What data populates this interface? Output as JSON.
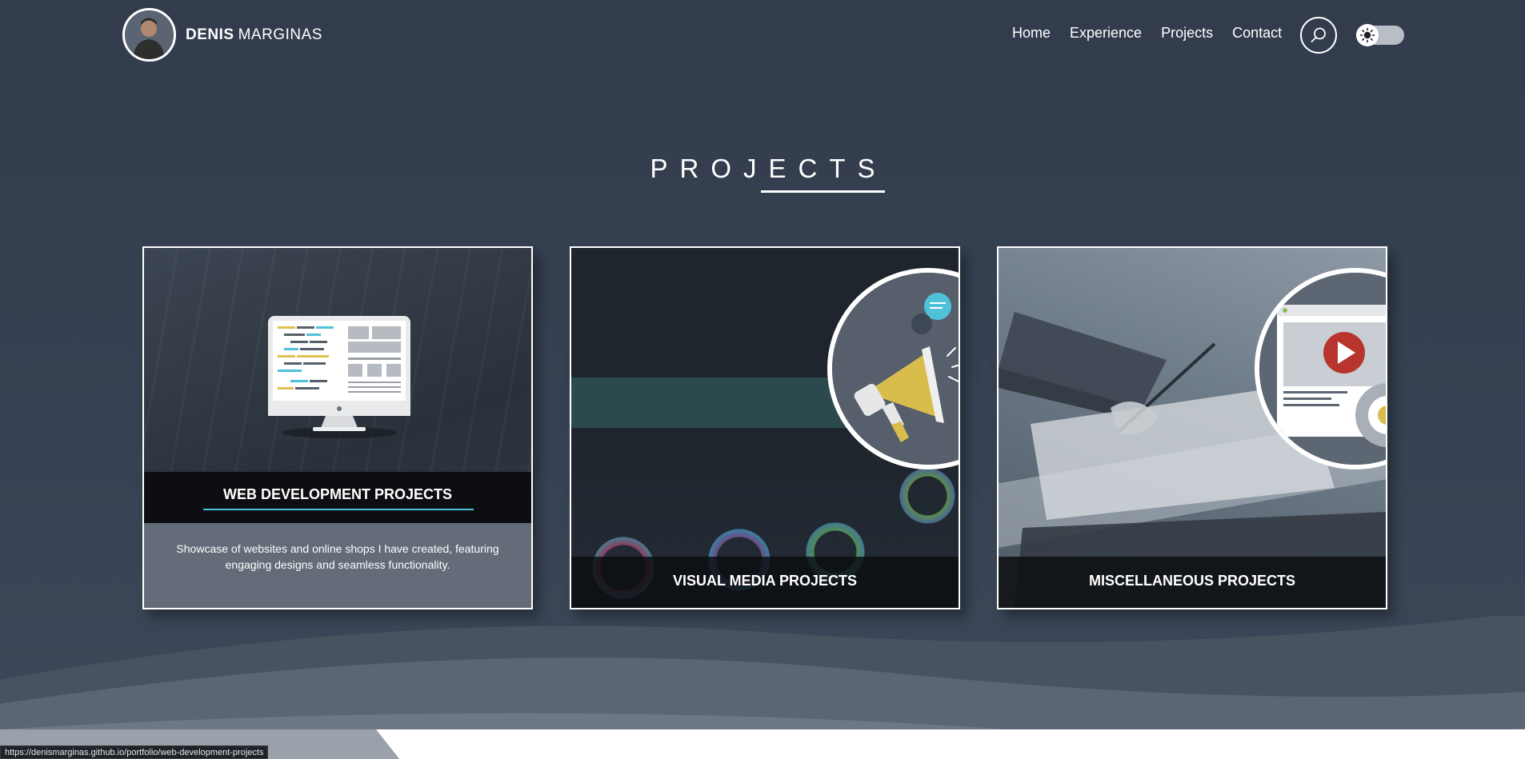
{
  "brand": {
    "first": "DENIS",
    "last": "MARGINAS"
  },
  "nav": {
    "items": [
      "Home",
      "Experience",
      "Projects",
      "Contact"
    ]
  },
  "icons": {
    "search": "search-icon",
    "theme": "sun-icon",
    "avatar": "avatar-photo"
  },
  "section": {
    "title": "PROJECTS"
  },
  "cards": [
    {
      "title": "WEB DEVELOPMENT PROJECTS",
      "description": "Showcase of websites and online shops I have created, featuring engaging designs and seamless functionality.",
      "icon": "monitor-code-icon"
    },
    {
      "title": "VISUAL MEDIA PROJECTS",
      "icon": "megaphone-icon"
    },
    {
      "title": "MISCELLANEOUS PROJECTS",
      "icon": "video-player-icon"
    }
  ],
  "status_bar": {
    "url": "https://denismarginas.github.io/portfolio/web-development-projects"
  },
  "colors": {
    "background": "#343e4e",
    "accent": "#4fc1d8",
    "text": "#ffffff",
    "megaphone": "#d8bd4c",
    "play_button": "#b8352d"
  }
}
